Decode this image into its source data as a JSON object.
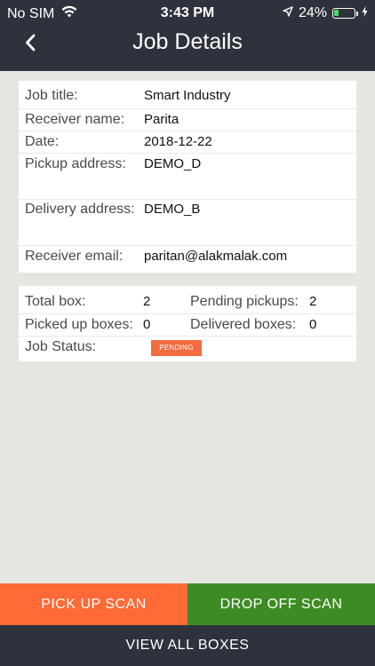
{
  "status_bar": {
    "carrier": "No SIM",
    "time": "3:43 PM",
    "battery_percent": "24%",
    "battery_level": 0.24,
    "battery_color": "#4cd964",
    "icons": [
      "wifi-icon",
      "location-arrow-icon",
      "battery-icon",
      "charging-bolt-icon"
    ]
  },
  "header": {
    "title": "Job Details",
    "background": "#2e323c",
    "back_icon": "chevron-left-icon"
  },
  "job_info": {
    "rows": [
      {
        "label": "Job title:",
        "value": "Smart Industry"
      },
      {
        "label": "Receiver name:",
        "value": "Parita"
      },
      {
        "label": "Date:",
        "value": "2018-12-22"
      },
      {
        "label": "Pickup address:",
        "value": "DEMO_D"
      },
      {
        "label": "Delivery address:",
        "value": "DEMO_B"
      },
      {
        "label": "Receiver email:",
        "value": "paritan@alakmalak.com"
      }
    ]
  },
  "box_stats": {
    "total_box_label": "Total box:",
    "total_box_value": "2",
    "pending_pickups_label": "Pending pickups:",
    "pending_pickups_value": "2",
    "picked_up_label": "Picked up boxes:",
    "picked_up_value": "0",
    "delivered_label": "Delivered boxes:",
    "delivered_value": "0",
    "job_status_label": "Job Status:",
    "job_status_badge": "PENDING",
    "badge_color": "#f26c3e"
  },
  "actions": {
    "pickup_scan": "PICK UP SCAN",
    "drop_off_scan": "DROP OFF SCAN",
    "view_all_boxes": "VIEW ALL BOXES",
    "pickup_color": "#ff6a36",
    "drop_color": "#3d8c23"
  }
}
